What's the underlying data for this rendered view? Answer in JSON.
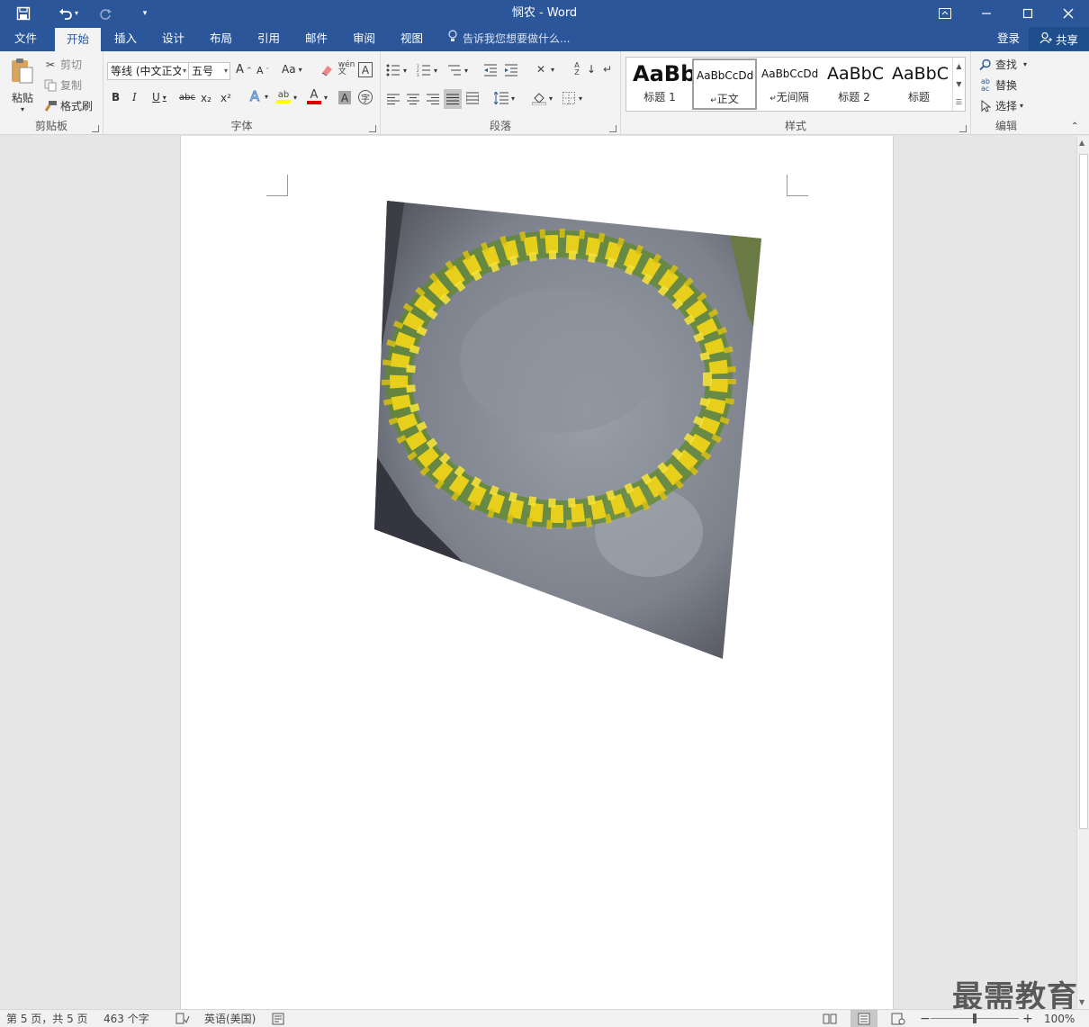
{
  "window": {
    "title": "悯农 - Word"
  },
  "quick_access": {
    "save_icon": "save-icon",
    "undo_icon": "undo-icon",
    "redo_icon": "redo-icon",
    "customize_icon": "customize-icon"
  },
  "tabs": [
    {
      "label": "文件"
    },
    {
      "label": "开始",
      "active": true
    },
    {
      "label": "插入"
    },
    {
      "label": "设计"
    },
    {
      "label": "布局"
    },
    {
      "label": "引用"
    },
    {
      "label": "邮件"
    },
    {
      "label": "审阅"
    },
    {
      "label": "视图"
    }
  ],
  "tellme": {
    "placeholder": "告诉我您想要做什么..."
  },
  "account": {
    "login": "登录",
    "share": "共享"
  },
  "clipboard": {
    "paste": "粘贴",
    "cut": "剪切",
    "copy": "复制",
    "format_painter": "格式刷",
    "label": "剪贴板"
  },
  "font": {
    "name": "等线 (中文正文)",
    "size": "五号",
    "label": "字体",
    "grow": "A",
    "shrink": "A",
    "case": "Aa",
    "bold": "B",
    "italic": "I",
    "underline": "U",
    "strike": "abc",
    "sub": "x₂",
    "sup": "x²"
  },
  "paragraph": {
    "label": "段落"
  },
  "styles": {
    "label": "样式",
    "items": [
      {
        "preview": "AaBb",
        "name": "标题 1"
      },
      {
        "preview": "AaBbCcDd",
        "name": "正文"
      },
      {
        "preview": "AaBbCcDd",
        "name": "无间隔"
      },
      {
        "preview": "AaBbC",
        "name": "标题 2"
      },
      {
        "preview": "AaBbC",
        "name": "标题"
      }
    ]
  },
  "editing": {
    "find": "查找",
    "replace": "替换",
    "select": "选择",
    "label": "编辑"
  },
  "statusbar": {
    "page": "第 5 页，共 5 页",
    "words": "463 个字",
    "language": "英语(美国)",
    "zoom": "100%"
  },
  "zoom_level": 1.0,
  "watermark": "最需教育",
  "colors": {
    "brand": "#2b579a",
    "highlight": "#ffff00",
    "font_color": "#e00000"
  }
}
